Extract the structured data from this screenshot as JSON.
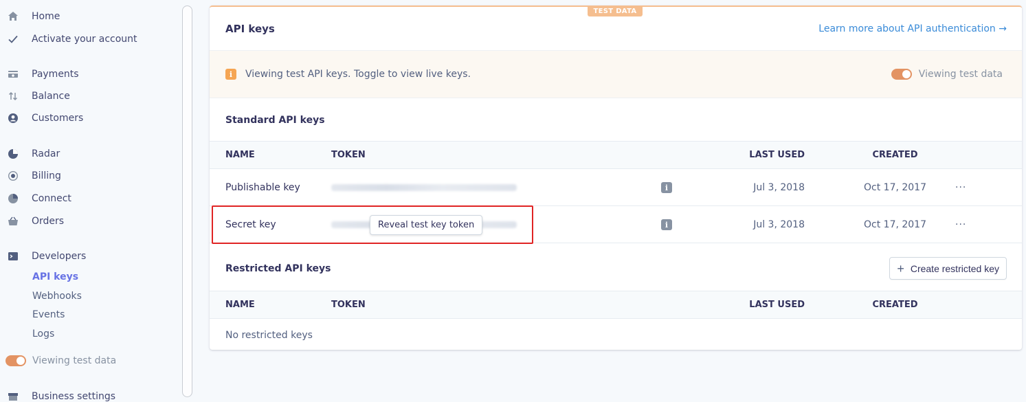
{
  "sidebar": {
    "home": "Home",
    "activate": "Activate your account",
    "payments": "Payments",
    "balance": "Balance",
    "customers": "Customers",
    "radar": "Radar",
    "billing": "Billing",
    "connect": "Connect",
    "orders": "Orders",
    "developers": "Developers",
    "api_keys": "API keys",
    "webhooks": "Webhooks",
    "events": "Events",
    "logs": "Logs",
    "viewing_test_data": "Viewing test data",
    "business_settings": "Business settings"
  },
  "card": {
    "badge": "TEST DATA",
    "title": "API keys",
    "learn_link": "Learn more about API authentication →",
    "banner_text": "Viewing test API keys. Toggle to view live keys.",
    "banner_toggle_label": "Viewing test data",
    "info_glyph": "i"
  },
  "standard": {
    "title": "Standard API keys",
    "headers": {
      "name": "NAME",
      "token": "TOKEN",
      "last_used": "LAST USED",
      "created": "CREATED"
    },
    "rows": [
      {
        "name": "Publishable key",
        "last_used": "Jul 3, 2018",
        "created": "Oct 17, 2017",
        "more": "···"
      },
      {
        "name": "Secret key",
        "last_used": "Jul 3, 2018",
        "created": "Oct 17, 2017",
        "more": "···"
      }
    ],
    "tooltip": "Reveal test key token"
  },
  "restricted": {
    "title": "Restricted API keys",
    "create_button": "Create restricted key",
    "create_plus": "+",
    "headers": {
      "name": "NAME",
      "token": "TOKEN",
      "last_used": "LAST USED",
      "created": "CREATED"
    },
    "empty": "No restricted keys"
  },
  "colors": {
    "accent": "#6772e5",
    "test_orange": "#f5be8f",
    "toggle": "#e39363",
    "link": "#3a8bd8",
    "highlight_red": "#e02424"
  }
}
